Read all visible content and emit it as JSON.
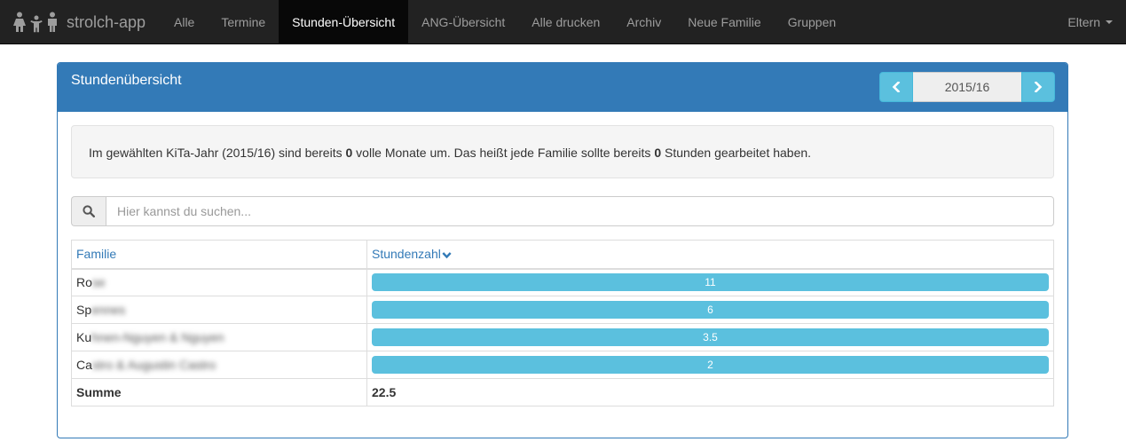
{
  "navbar": {
    "brand": "strolch-app",
    "items": [
      {
        "label": "Alle",
        "active": false
      },
      {
        "label": "Termine",
        "active": false
      },
      {
        "label": "Stunden-Übersicht",
        "active": true
      },
      {
        "label": "ANG-Übersicht",
        "active": false
      },
      {
        "label": "Alle drucken",
        "active": false
      },
      {
        "label": "Archiv",
        "active": false
      },
      {
        "label": "Neue Familie",
        "active": false
      },
      {
        "label": "Gruppen",
        "active": false
      }
    ],
    "right_menu": "Eltern"
  },
  "panel": {
    "title": "Stundenübersicht",
    "year": "2015/16"
  },
  "info": {
    "part1": "Im gewählten KiTa-Jahr (2015/16) sind bereits ",
    "months": "0",
    "part2": " volle Monate um. Das heißt jede Familie sollte bereits ",
    "hours": "0",
    "part3": " Stunden gearbeitet haben."
  },
  "search": {
    "placeholder": "Hier kannst du suchen..."
  },
  "table": {
    "headers": {
      "family": "Familie",
      "hours": "Stundenzahl"
    },
    "rows": [
      {
        "family_visible": "Ro",
        "family_blurred": "se",
        "hours": 11,
        "label": "11"
      },
      {
        "family_visible": "Sp",
        "family_blurred": "ennes",
        "hours": 6,
        "label": "6"
      },
      {
        "family_visible": "Ku",
        "family_blurred": "hnen-Nguyen & Nguyen",
        "hours": 3.5,
        "label": "3.5"
      },
      {
        "family_visible": "Ca",
        "family_blurred": "stro & Augustin Castro",
        "hours": 2,
        "label": "2"
      }
    ],
    "sum_label": "Summe",
    "sum_value": "22.5"
  },
  "colors": {
    "navbar": "#222222",
    "panel": "#337ab7",
    "bar": "#5bc0de"
  }
}
